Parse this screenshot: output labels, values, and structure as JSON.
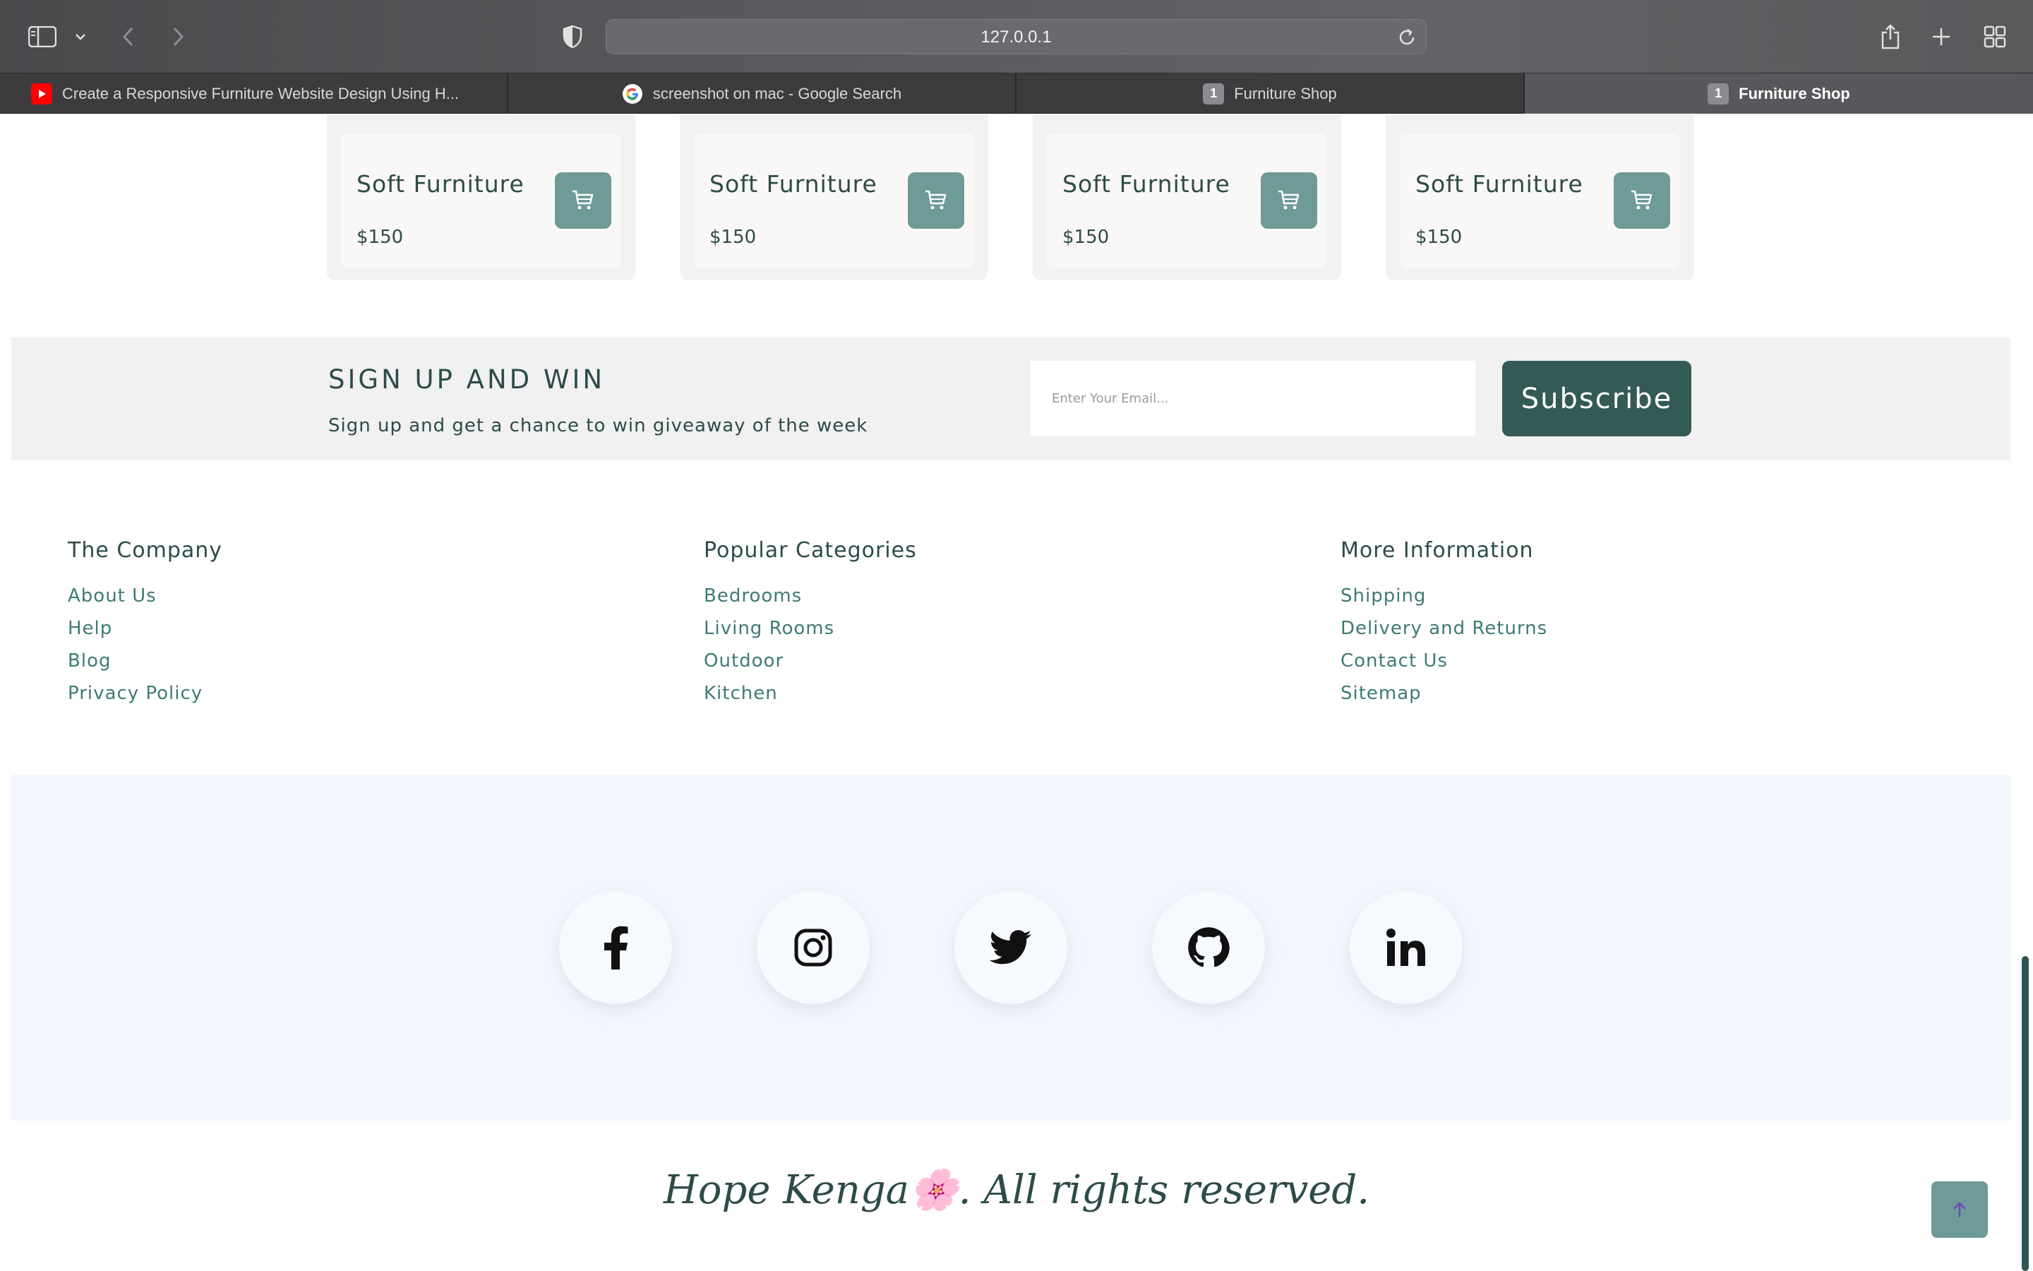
{
  "browser": {
    "url": "127.0.0.1",
    "tabs": [
      {
        "label": "Create a Responsive Furniture Website Design Using H...",
        "icon": "youtube-icon",
        "active": false
      },
      {
        "label": "screenshot on mac - Google Search",
        "icon": "google-icon",
        "active": false
      },
      {
        "label": "Furniture Shop",
        "icon": "numbered-tab-icon",
        "badge": "1",
        "active": false
      },
      {
        "label": "Furniture Shop",
        "icon": "numbered-tab-icon",
        "badge": "1",
        "active": true
      }
    ]
  },
  "products": [
    {
      "name": "Soft Furniture",
      "price": "$150"
    },
    {
      "name": "Soft Furniture",
      "price": "$150"
    },
    {
      "name": "Soft Furniture",
      "price": "$150"
    },
    {
      "name": "Soft Furniture",
      "price": "$150"
    }
  ],
  "signup": {
    "title": "SIGN UP AND WIN",
    "subtitle": "Sign up and get a chance to win giveaway of the week",
    "email_placeholder": "Enter Your Email...",
    "button_label": "Subscribe"
  },
  "footer": {
    "columns": [
      {
        "title": "The Company",
        "links": [
          "About Us",
          "Help",
          "Blog",
          "Privacy Policy"
        ]
      },
      {
        "title": "Popular Categories",
        "links": [
          "Bedrooms",
          "Living Rooms",
          "Outdoor",
          "Kitchen"
        ]
      },
      {
        "title": "More Information",
        "links": [
          "Shipping",
          "Delivery and Returns",
          "Contact Us",
          "Sitemap"
        ]
      }
    ],
    "social": [
      "facebook-icon",
      "instagram-icon",
      "twitter-icon",
      "github-icon",
      "linkedin-icon"
    ],
    "credit": "Hope Kenga🌸. All rights reserved."
  },
  "colors": {
    "brand_dark": "#345a56",
    "brand_accent": "#6e9a98",
    "text_primary": "#2d4b49",
    "link": "#3f7a76",
    "social_band": "#f3f7fd",
    "signup_band": "#f1f1f1"
  }
}
